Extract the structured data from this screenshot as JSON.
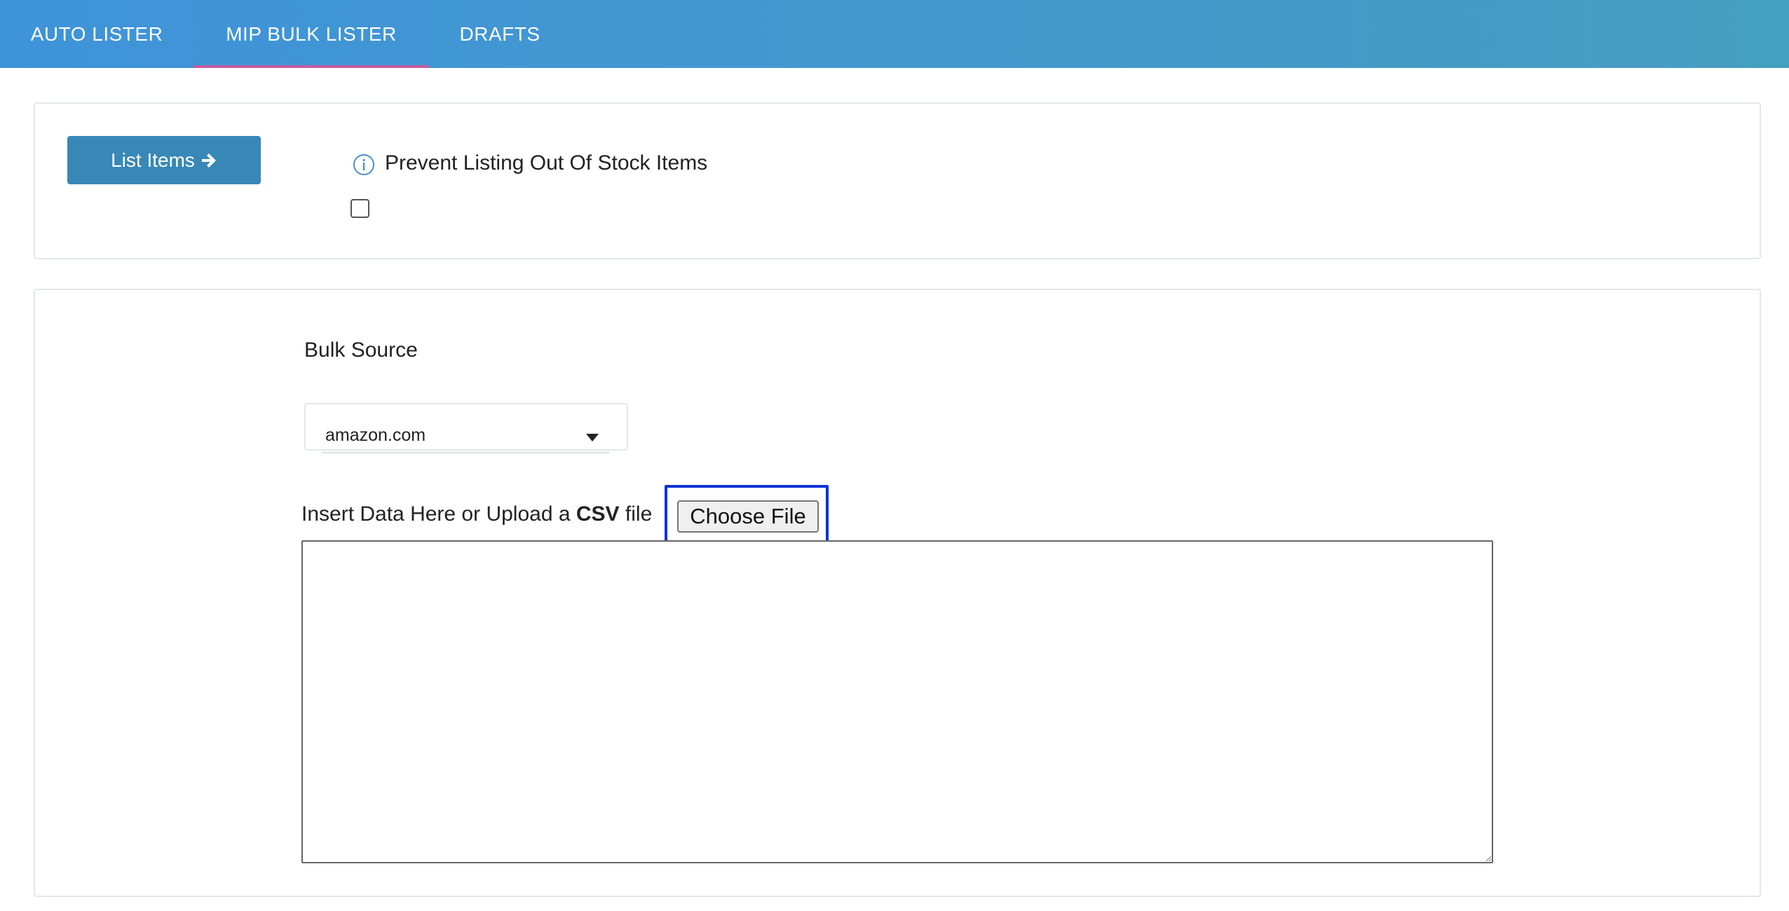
{
  "tabs": [
    {
      "label": "AUTO LISTER",
      "active": false
    },
    {
      "label": "MIP BULK LISTER",
      "active": true
    },
    {
      "label": "DRAFTS",
      "active": false
    }
  ],
  "actions": {
    "list_items_label": "List Items"
  },
  "options": {
    "prevent_out_of_stock_label": "Prevent Listing Out Of Stock Items",
    "prevent_out_of_stock_checked": false
  },
  "bulk": {
    "source_label": "Bulk Source",
    "source_selected": "amazon.com",
    "insert_prefix": "Insert Data Here or Upload a ",
    "insert_bold": "CSV",
    "insert_suffix": " file",
    "choose_file_label": "Choose File",
    "data_value": ""
  },
  "colors": {
    "topbar_start": "#3f93d9",
    "topbar_end": "#459fbf",
    "active_tab_underline": "#c75b9f",
    "primary_button": "#3888b7",
    "focus_outline": "#0b33d8"
  },
  "icons": {
    "list_items_icon": "arrow-right-icon",
    "info_icon": "info-icon",
    "select_icon": "caret-down-icon"
  }
}
